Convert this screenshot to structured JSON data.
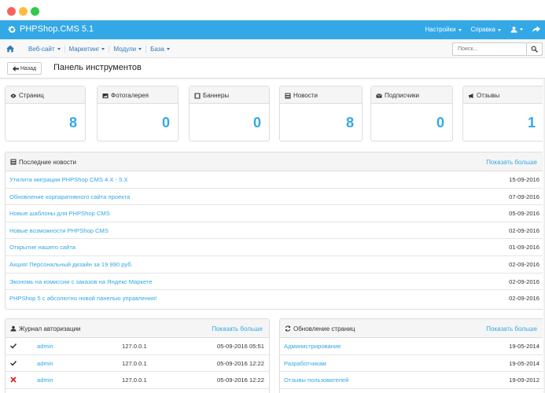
{
  "brand": {
    "title": "PHPShop.CMS 5.1",
    "icon": "gear-icon"
  },
  "topnav": {
    "settings": "Настройки",
    "help": "Справка",
    "user_icon": "user-icon",
    "exit_icon": "share-icon"
  },
  "menu": [
    "Веб-сайт",
    "Маркетинг",
    "Модули",
    "База"
  ],
  "search": {
    "placeholder": "Поиск..."
  },
  "subheader": {
    "back_label": "Назад",
    "title": "Панель инструментов"
  },
  "stats": [
    {
      "label": "Страниц",
      "value": "8",
      "icon": "eye-icon"
    },
    {
      "label": "Фотогалерея",
      "value": "0",
      "icon": "picture-icon"
    },
    {
      "label": "Баннеры",
      "value": "0",
      "icon": "film-icon"
    },
    {
      "label": "Новости",
      "value": "8",
      "icon": "news-icon"
    },
    {
      "label": "Подписчики",
      "value": "0",
      "icon": "envelope-icon"
    },
    {
      "label": "Отзывы",
      "value": "1",
      "icon": "bullhorn-icon"
    }
  ],
  "news": {
    "title": "Последние новости",
    "more": "Показать больше",
    "items": [
      {
        "title": "Утилита миграции PHPShop CMS 4.X - 5.X",
        "date": "15-09-2016"
      },
      {
        "title": "Обновление корпаративного сайта проекта",
        "date": "07-09-2016"
      },
      {
        "title": "Новые шаблоны для PHPShop CMS",
        "date": "05-09-2016"
      },
      {
        "title": "Новые возможности PHPShop CMS",
        "date": "02-09-2016"
      },
      {
        "title": "Открытие нашего сайта",
        "date": "01-09-2016"
      },
      {
        "title": "Акция! Персональный дизайн за 19 990 руб.",
        "date": "02-09-2016"
      },
      {
        "title": "Экономь на комиссии с заказов на Яндекс Маркете",
        "date": "02-09-2016"
      },
      {
        "title": "PHPShop 5 с абсолютно новой панелью управления!",
        "date": "02-09-2016"
      }
    ]
  },
  "auth": {
    "title": "Журнал авторизации",
    "more": "Показать больше",
    "rows": [
      {
        "status": "ok",
        "user": "admin",
        "ip": "127.0.0.1",
        "date": "05-09-2016 05:51"
      },
      {
        "status": "ok",
        "user": "admin",
        "ip": "127.0.0.1",
        "date": "05-09-2016 12:22"
      },
      {
        "status": "fail",
        "user": "admin",
        "ip": "127.0.0.1",
        "date": "05-09-2016 12:22"
      }
    ]
  },
  "updates": {
    "title": "Обновление страниц",
    "more": "Показать больше",
    "items": [
      {
        "title": "Администрирование",
        "date": "19-05-2014"
      },
      {
        "title": "Разработчикам",
        "date": "19-05-2014"
      },
      {
        "title": "Отзывы пользователей",
        "date": "19-09-2012"
      }
    ]
  },
  "colors": {
    "accent": "#33a8e6",
    "ok": "#333333",
    "fail": "#e02020"
  }
}
